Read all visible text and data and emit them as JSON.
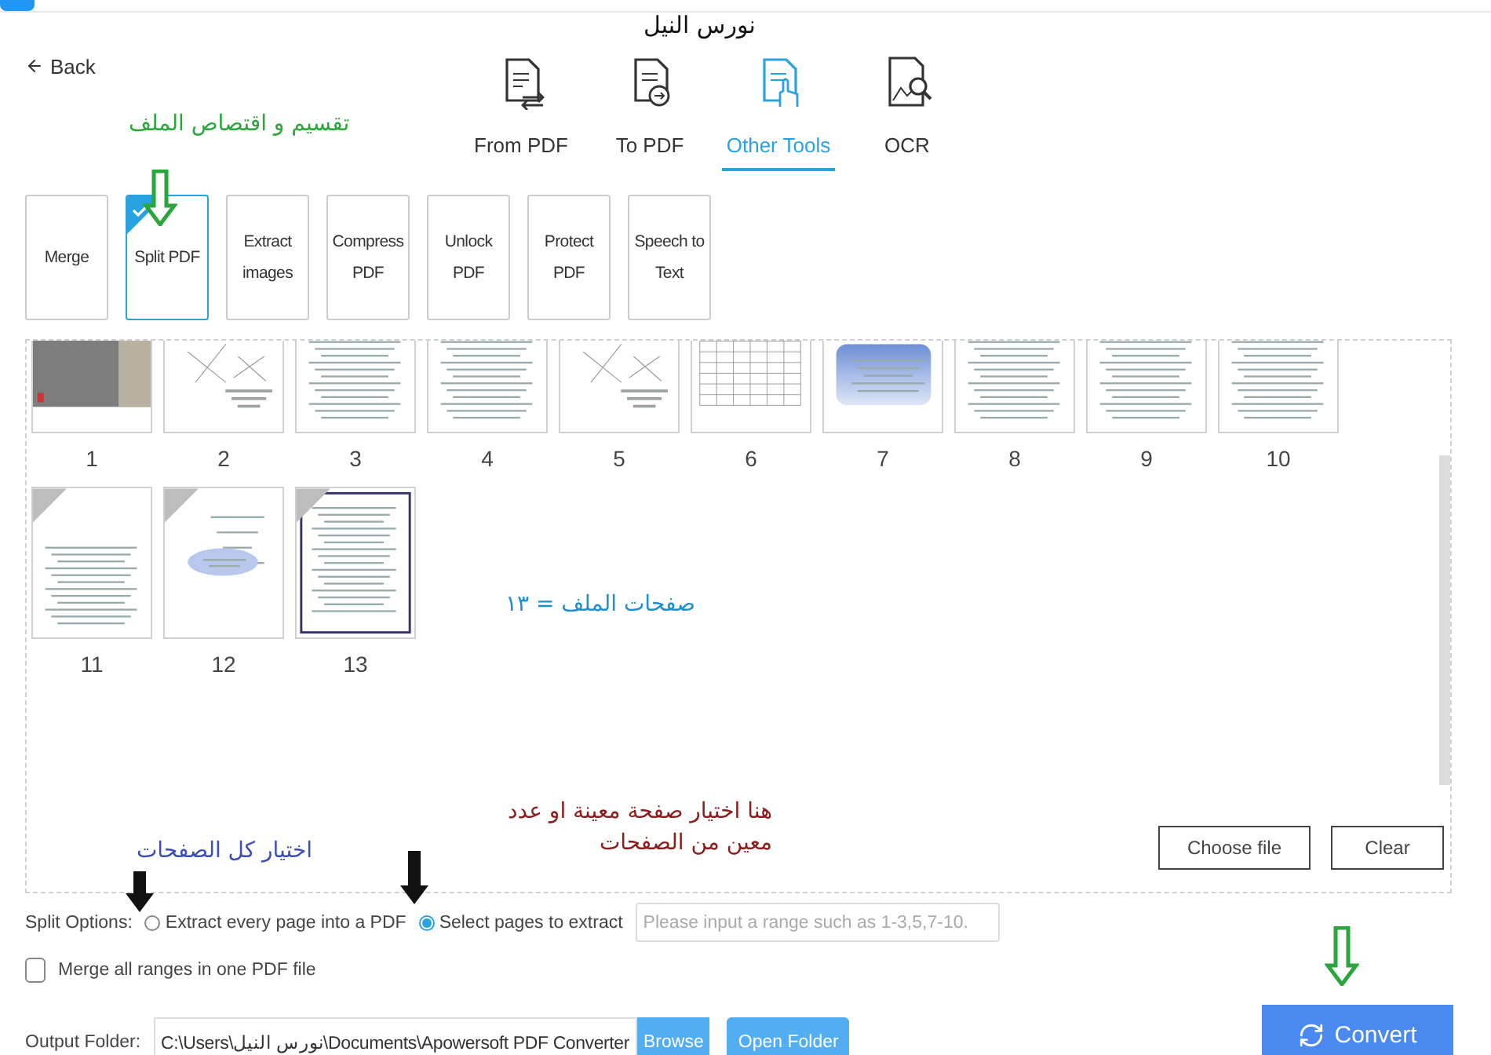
{
  "header": {
    "back": "Back"
  },
  "tabs": [
    {
      "label": "From PDF",
      "kind": "from",
      "selected": false
    },
    {
      "label": "To PDF",
      "kind": "to",
      "selected": false
    },
    {
      "label": "Other Tools",
      "kind": "tools",
      "selected": true
    },
    {
      "label": "OCR",
      "kind": "ocr",
      "selected": false
    }
  ],
  "tools": [
    {
      "label": "Merge",
      "selected": false
    },
    {
      "label": "Split PDF",
      "selected": true
    },
    {
      "label": "Extract images",
      "selected": false
    },
    {
      "label": "Compress PDF",
      "selected": false
    },
    {
      "label": "Unlock PDF",
      "selected": false
    },
    {
      "label": "Protect PDF",
      "selected": false
    },
    {
      "label": "Speech to Text",
      "selected": false
    }
  ],
  "pages": [
    {
      "number": "1",
      "kind": "photo"
    },
    {
      "number": "2",
      "kind": "diagram"
    },
    {
      "number": "3",
      "kind": "text"
    },
    {
      "number": "4",
      "kind": "text"
    },
    {
      "number": "5",
      "kind": "diagram"
    },
    {
      "number": "6",
      "kind": "grid"
    },
    {
      "number": "7",
      "kind": "bluebox"
    },
    {
      "number": "8",
      "kind": "text"
    },
    {
      "number": "9",
      "kind": "text"
    },
    {
      "number": "10",
      "kind": "text"
    },
    {
      "number": "11",
      "kind": "text",
      "selected": true
    },
    {
      "number": "12",
      "kind": "ellipse",
      "selected": true
    },
    {
      "number": "13",
      "kind": "framed",
      "selected": true
    }
  ],
  "panel_buttons": [
    "Choose file",
    "Clear"
  ],
  "split_options": {
    "label": "Split Options:",
    "options": [
      {
        "label": "Extract every page into a PDF",
        "selected": false
      },
      {
        "label": "Select pages to extract",
        "selected": true
      }
    ],
    "range_placeholder": "Please input a range such as 1-3,5,7-10."
  },
  "merge": {
    "label": "Merge all ranges in one PDF file",
    "checked": false
  },
  "output": {
    "label": "Output Folder:",
    "path": "C:\\Users\\نورس النيل\\Documents\\Apowersoft PDF Converter",
    "browse": "Browse",
    "open_folder": "Open Folder"
  },
  "convert": "Convert",
  "annotations": [
    {
      "text": "نورس النيل",
      "color": "#111111"
    },
    {
      "text": "تقسيم و اقتصاص الملف",
      "color": "#2ba63c"
    },
    {
      "text": "صفحات الملف = ١٣",
      "color": "#1f8fca"
    },
    {
      "text": "هنا اختيار صفحة معينة او عدد معين من الصفحات",
      "color": "#8b1c1c"
    },
    {
      "text": "اختيار كل الصفحات",
      "color": "#3d4fb3"
    }
  ],
  "arrows": [
    {
      "color": "#2ba63c",
      "kind": "hollow"
    },
    {
      "color": "#111111",
      "kind": "solid"
    },
    {
      "color": "#111111",
      "kind": "solid"
    },
    {
      "color": "#2ba63c",
      "kind": "hollow"
    }
  ]
}
